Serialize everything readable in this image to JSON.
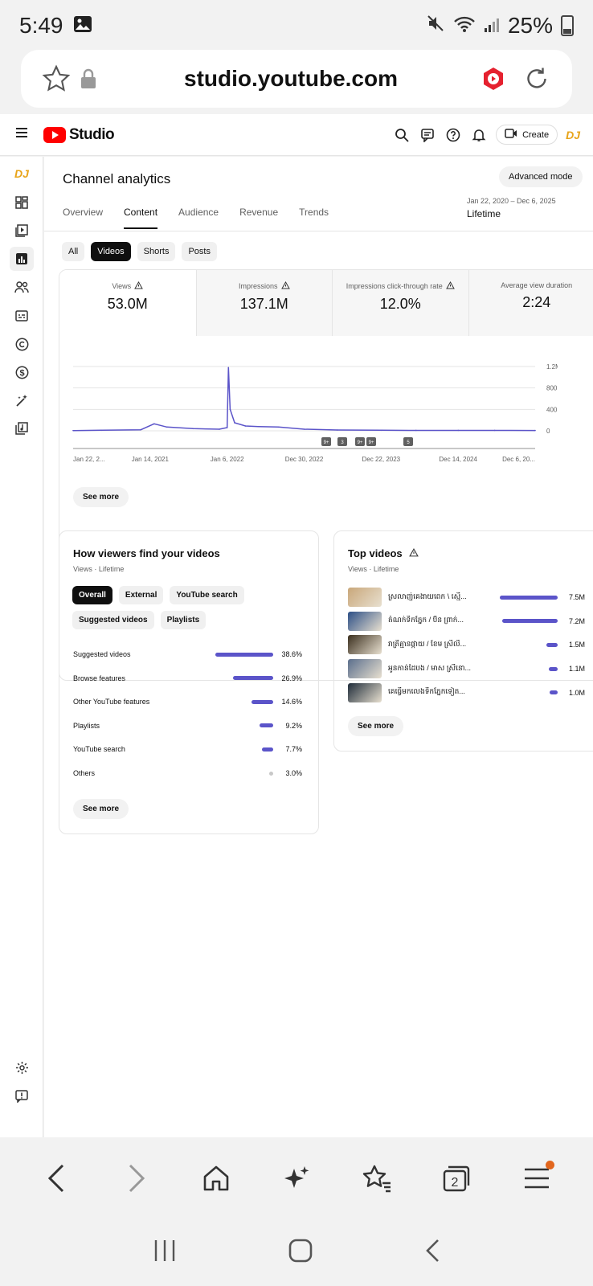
{
  "status": {
    "time": "5:49",
    "battery": "25%"
  },
  "browser": {
    "url": "studio.youtube.com",
    "tab_count": "2"
  },
  "header": {
    "logo_text": "Studio",
    "create_label": "Create",
    "avatar_label": "DJ"
  },
  "page": {
    "title": "Channel analytics",
    "advanced_label": "Advanced mode",
    "tabs": [
      "Overview",
      "Content",
      "Audience",
      "Revenue",
      "Trends"
    ],
    "active_tab": "Content",
    "date_range": "Jan 22, 2020 – Dec 6, 2025",
    "date_preset": "Lifetime"
  },
  "content_chips": [
    "All",
    "Videos",
    "Shorts",
    "Posts"
  ],
  "metrics": [
    {
      "label": "Views",
      "value": "53.0M",
      "warning": true
    },
    {
      "label": "Impressions",
      "value": "137.1M",
      "warning": true
    },
    {
      "label": "Impressions click-through rate",
      "value": "12.0%",
      "warning": true
    },
    {
      "label": "Average view duration",
      "value": "2:24",
      "warning": false
    }
  ],
  "chart_data": {
    "type": "line",
    "x_tick_labels": [
      "Jan 22, 2...",
      "Jan 14, 2021",
      "Jan 6, 2022",
      "Dec 30, 2022",
      "Dec 22, 2023",
      "Dec 14, 2024",
      "Dec 6, 20..."
    ],
    "y_tick_labels": [
      "1.2M",
      "800.0K",
      "400.0K",
      "0"
    ],
    "ylim": [
      0,
      1200000
    ],
    "x": [
      "2020-01-22",
      "2020-06-01",
      "2020-12-01",
      "2021-02-01",
      "2021-04-01",
      "2021-08-01",
      "2021-12-01",
      "2022-01-06",
      "2022-01-12",
      "2022-01-20",
      "2022-02-10",
      "2022-04-01",
      "2022-06-01",
      "2022-09-01",
      "2022-12-30",
      "2023-06-01",
      "2023-12-22",
      "2024-06-01",
      "2024-12-14",
      "2025-06-01",
      "2025-12-06"
    ],
    "series": [
      {
        "values": [
          5000,
          10000,
          20000,
          130000,
          70000,
          40000,
          30000,
          60000,
          1180000,
          400000,
          150000,
          90000,
          80000,
          70000,
          30000,
          15000,
          10000,
          8000,
          8000,
          8000,
          6000
        ]
      }
    ],
    "annotations": [
      "9+",
      "3",
      "9+",
      "9+",
      "5"
    ],
    "grid": true
  },
  "chart_see_more": "See more",
  "traffic": {
    "title": "How viewers find your videos",
    "subtitle": "Views · Lifetime",
    "chips": [
      "Overall",
      "External",
      "YouTube search",
      "Suggested videos",
      "Playlists"
    ],
    "rows": [
      {
        "name": "Suggested videos",
        "pct": "38.6%",
        "value": 38.6
      },
      {
        "name": "Browse features",
        "pct": "26.9%",
        "value": 26.9
      },
      {
        "name": "Other YouTube features",
        "pct": "14.6%",
        "value": 14.6
      },
      {
        "name": "Playlists",
        "pct": "9.2%",
        "value": 9.2
      },
      {
        "name": "YouTube search",
        "pct": "7.7%",
        "value": 7.7
      },
      {
        "name": "Others",
        "pct": "3.0%",
        "value": 3.0
      }
    ],
    "see_more": "See more"
  },
  "top_videos": {
    "title": "Top videos",
    "subtitle": "Views · Lifetime",
    "rows": [
      {
        "title": "ស្រលាញ់គេងាយពេក \\ ស្មើ...",
        "views": "7.5M",
        "value": 7.5,
        "color": "#c9a77a"
      },
      {
        "title": "តំណក់ទឹកភ្នែក / ប៊ិន ព្រាក់...",
        "views": "7.2M",
        "value": 7.2,
        "color": "#2c4f86"
      },
      {
        "title": "រាត្រីគ្មានផ្កាយ / ខែម ស្រីលី...",
        "views": "1.5M",
        "value": 1.5,
        "color": "#3b2f1e"
      },
      {
        "title": "អូនកាន់ដៃបង / មាស ស្រីនោ...",
        "views": "1.1M",
        "value": 1.1,
        "color": "#5a6e8c"
      },
      {
        "title": "គេធ្វើមកលេងទឹកភ្នែកទៀត...",
        "views": "1.0M",
        "value": 1.0,
        "color": "#1f2c3a"
      }
    ],
    "see_more": "See more"
  }
}
